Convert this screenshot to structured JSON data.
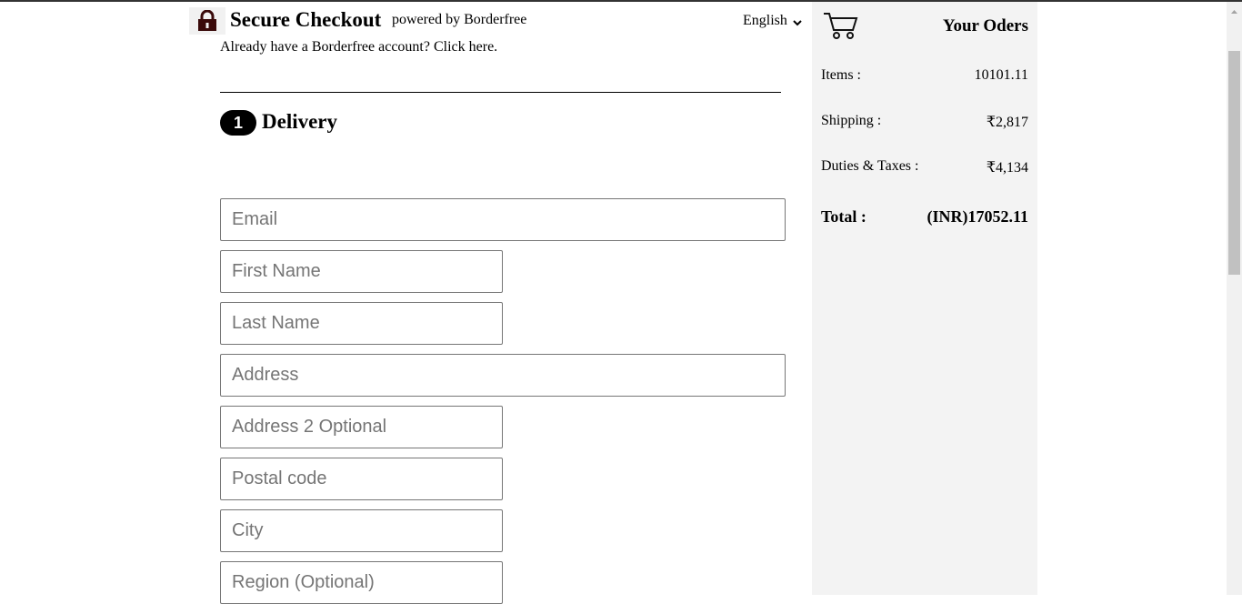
{
  "header": {
    "title": "Secure Checkout",
    "powered_by": "powered by Borderfree",
    "language": "English",
    "account_link": "Already have a Borderfree account? Click here."
  },
  "step": {
    "number": "1",
    "title": "Delivery"
  },
  "form": {
    "email_placeholder": "Email",
    "first_name_placeholder": "First Name",
    "last_name_placeholder": "Last Name",
    "address_placeholder": "Address",
    "address2_placeholder": "Address 2 Optional",
    "postal_placeholder": "Postal code",
    "city_placeholder": "City",
    "region_placeholder": "Region (Optional)"
  },
  "summary": {
    "title": "Your Oders",
    "items_label": "Items :",
    "items_value": "10101.11",
    "shipping_label": "Shipping :",
    "shipping_value": "₹2,817",
    "duties_label": "Duties & Taxes :",
    "duties_value": "₹4,134",
    "total_label": "Total :",
    "total_value": "(INR)17052.11"
  },
  "icons": {
    "lock": "lock-icon",
    "cart": "cart-icon",
    "chevron": "chevron-down-icon"
  },
  "colors": {
    "sidebar_bg": "#f3f3f3",
    "lock_color": "#3a0a0a"
  }
}
